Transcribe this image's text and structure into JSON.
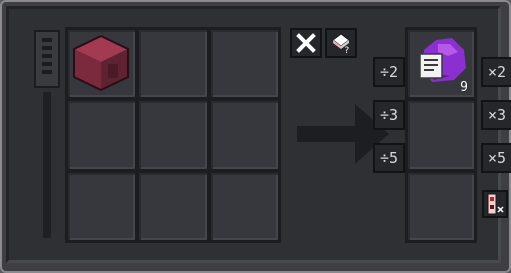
{
  "operations": {
    "divide": [
      "÷2",
      "÷3",
      "÷5"
    ],
    "multiply": [
      "×2",
      "×3",
      "×5"
    ]
  },
  "output": {
    "item_icon": "purple-dust-recipe-icon",
    "count": "9"
  },
  "grid": {
    "first_slot_item": "crimson-block-icon"
  },
  "buttons": {
    "clear_icon": "close-icon",
    "sort_icon": "eraser-question-icon",
    "redstone_icon": "redstone-mode-icon"
  },
  "colors": {
    "background": "#2f3034",
    "slot": "#37383d",
    "button": "#26272b",
    "block": "#7a2a3c",
    "dust": "#8b2fd0"
  }
}
